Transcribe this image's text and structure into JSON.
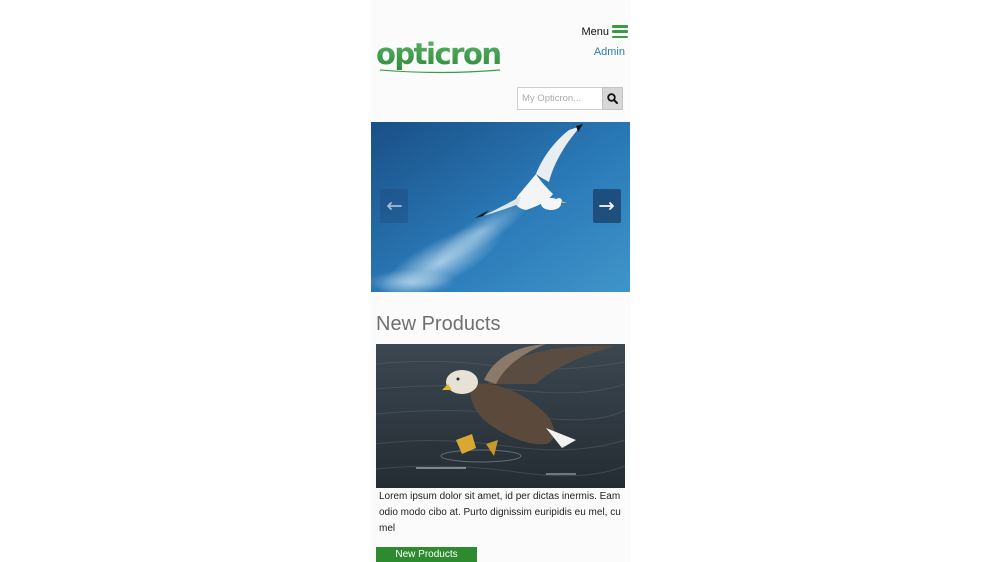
{
  "header": {
    "logo_text": "opticron",
    "menu_label": "Menu",
    "admin_link": "Admin"
  },
  "search": {
    "placeholder": "My Opticron..."
  },
  "hero": {
    "image": "seagull-flying-blue-sky",
    "prev_icon": "arrow-left-icon",
    "next_icon": "arrow-right-icon"
  },
  "new_products": {
    "title": "New Products",
    "image": "white-tailed-eagle-catching-fish",
    "description": "Lorem ipsum dolor sit amet, id per dictas inermis. Eam odio modo cibo at. Purto dignissim euripidis eu mel, cu mel",
    "button_label": "New Products"
  },
  "colors": {
    "brand_green": "#3a9a48",
    "link_blue": "#2a7ac0",
    "button_green": "#2e8a2e"
  }
}
